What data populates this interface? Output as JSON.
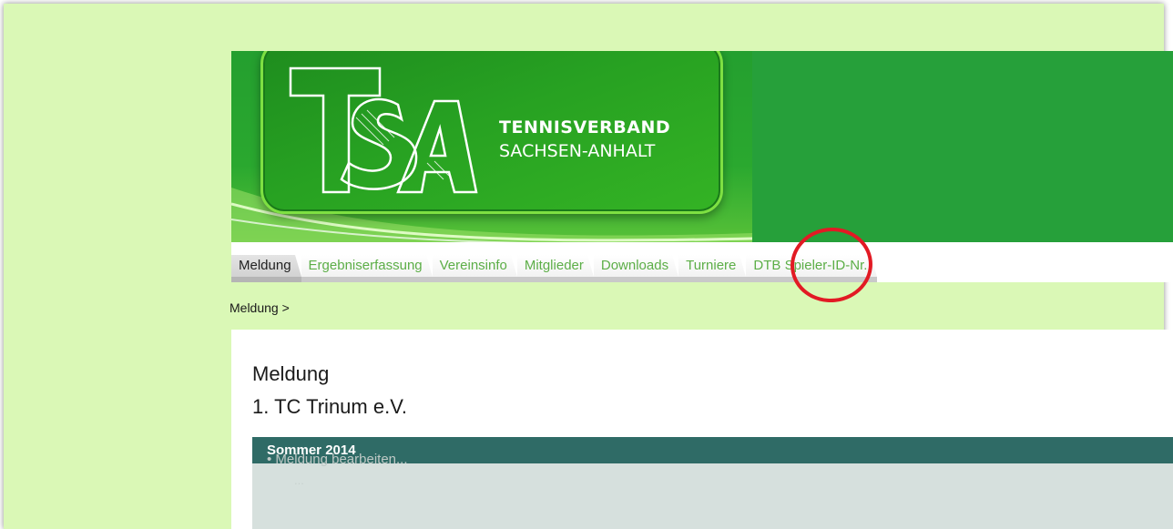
{
  "header": {
    "brand_line1": "TENNISVERBAND",
    "brand_line2": "SACHSEN-ANHALT",
    "logo_text": "TSA"
  },
  "nav": {
    "tabs": [
      {
        "label": "Meldung",
        "active": true
      },
      {
        "label": "Ergebniserfassung",
        "active": false
      },
      {
        "label": "Vereinsinfo",
        "active": false
      },
      {
        "label": "Mitglieder",
        "active": false
      },
      {
        "label": "Downloads",
        "active": false
      },
      {
        "label": "Turniere",
        "active": false
      },
      {
        "label": "DTB Spieler-ID-Nr.",
        "active": false
      }
    ]
  },
  "breadcrumb": {
    "current": "Meldung",
    "separator": ">"
  },
  "content": {
    "title": "Meldung",
    "club": "1. TC Trinum e.V.",
    "season": "Sommer 2014",
    "faded_link": "• Meldung bearbeiten...",
    "faded_sub": "..."
  },
  "colors": {
    "page_bg": "#daf8b6",
    "header_green": "#26a03a",
    "tab_text": "#5cae47",
    "season_bar": "#2f6b66",
    "annotation": "#e21a24"
  }
}
